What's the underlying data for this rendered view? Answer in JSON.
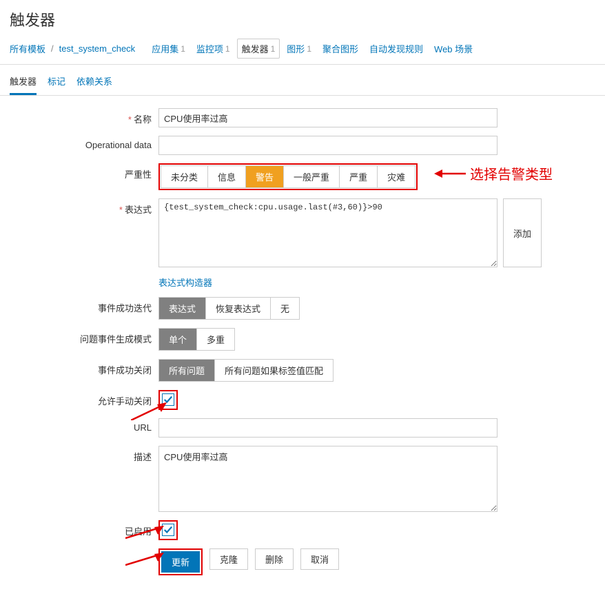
{
  "page_title": "触发器",
  "breadcrumb": {
    "all_templates": "所有模板",
    "template_name": "test_system_check",
    "items": [
      {
        "label": "应用集",
        "count": "1"
      },
      {
        "label": "监控项",
        "count": "1"
      },
      {
        "label": "触发器",
        "count": "1"
      },
      {
        "label": "图形",
        "count": "1"
      },
      {
        "label": "聚合图形",
        "count": ""
      },
      {
        "label": "自动发现规则",
        "count": ""
      },
      {
        "label": "Web 场景",
        "count": ""
      }
    ]
  },
  "tabs": [
    "触发器",
    "标记",
    "依赖关系"
  ],
  "labels": {
    "name": "名称",
    "opdata": "Operational data",
    "severity": "严重性",
    "expression": "表达式",
    "event_iter": "事件成功迭代",
    "problem_mode": "问题事件生成模式",
    "event_close": "事件成功关闭",
    "allow_manual": "允许手动关闭",
    "url": "URL",
    "description": "描述",
    "enabled": "已启用"
  },
  "values": {
    "name": "CPU使用率过高",
    "opdata": "",
    "expression": "{test_system_check:cpu.usage.last(#3,60)}>90",
    "url": "",
    "description": "CPU使用率过高"
  },
  "severity_options": [
    "未分类",
    "信息",
    "警告",
    "一般严重",
    "严重",
    "灾难"
  ],
  "event_iter_options": [
    "表达式",
    "恢复表达式",
    "无"
  ],
  "problem_mode_options": [
    "单个",
    "多重"
  ],
  "event_close_options": [
    "所有问题",
    "所有问题如果标签值匹配"
  ],
  "buttons": {
    "add": "添加",
    "expr_builder": "表达式构造器",
    "update": "更新",
    "clone": "克隆",
    "delete": "删除",
    "cancel": "取消"
  },
  "annotation": "选择告警类型"
}
